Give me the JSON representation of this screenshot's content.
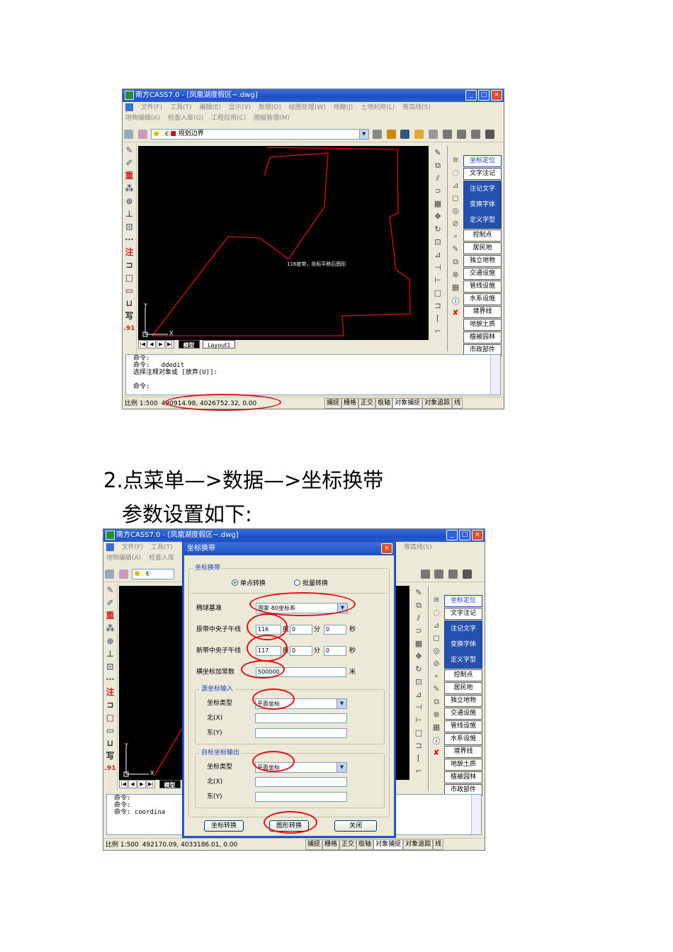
{
  "screenshot1": {
    "app_title": "南方CASS7.0 - [凤凰湖度假区~.dwg]",
    "menu_row1": [
      "文件(F)",
      "工具(T)",
      "编辑(E)",
      "显示(V)",
      "数据(D)",
      "绘图处理(W)",
      "地籍(J)",
      "土地利用(L)",
      "等高线(S)"
    ],
    "menu_row2": [
      "地物编辑(A)",
      "检查入库(G)",
      "工程应用(C)",
      "图幅管理(M)"
    ],
    "layer_name": "规划边界",
    "left_tool_labels": [
      "重",
      "注",
      ".91"
    ],
    "canvas_label": "116度带，坐标平移后图形",
    "axis_y": "Y",
    "axis_x": "X",
    "tab_model": "模型",
    "tab_layout": "Layout1",
    "side_items_top": [
      "坐标定位",
      "文字注记"
    ],
    "side_blue_items": [
      "注记文字",
      "变换字体",
      "定义字型"
    ],
    "side_items": [
      "控制点",
      "居民地",
      "独立地物",
      "交通设施",
      "管线设施",
      "水系设施",
      "境界线",
      "地貌土质",
      "植被园林",
      "市政部件"
    ],
    "command_lines": [
      "命令:",
      "命令:   ddedit",
      "选择注释对象或 [放弃(U)]:",
      "",
      "命令:"
    ],
    "status_scale": "比例  1:500",
    "status_coords": "490914.98, 4026752.32, 0.00",
    "status_buttons": [
      "捕捉",
      "栅格",
      "正交",
      "极轴",
      "对象捕捉",
      "对象追踪",
      "线"
    ]
  },
  "heading1": "2.点菜单—>数据—>坐标换带",
  "heading2": "参数设置如下:",
  "screenshot2": {
    "app_title": "南方CASS7.0 - [凤凰湖度假区~.dwg]",
    "menu_row1": [
      "文件(F)",
      "工具(T)"
    ],
    "menu_row1_right": "等高线(S)",
    "menu_row2": [
      "地物编辑(A)",
      "检查入库"
    ],
    "left_tool_labels": [
      "重",
      "注",
      ".91"
    ],
    "axis_y": "Y",
    "axis_x": "X",
    "tab_model": "模型",
    "side_items_top": [
      "坐标定位",
      "文字注记"
    ],
    "side_blue_items": [
      "注记文字",
      "变换字体",
      "定义字型"
    ],
    "side_items": [
      "控制点",
      "居民地",
      "独立地物",
      "交通设施",
      "管线设施",
      "水系设施",
      "境界线",
      "地貌土质",
      "植被园林",
      "市政部件"
    ],
    "command_lines": [
      "命令:",
      "命令:",
      "命令: coordina"
    ],
    "status_scale": "比例  1:500",
    "status_coords": "492170.09, 4033186.01, 0.00",
    "status_buttons": [
      "捕捉",
      "栅格",
      "正交",
      "极轴",
      "对象捕捉",
      "对象追踪",
      "线"
    ],
    "dialog": {
      "title": "坐标换带",
      "group_main": "坐标换带",
      "radio_single": "单点转换",
      "radio_batch": "批量转换",
      "ellipsoid_label": "椭球基准",
      "ellipsoid_value": "国家-80坐标系",
      "orig_meridian_label": "原带中央子午线",
      "orig_meridian_deg": "116",
      "new_meridian_label": "新带中央子午线",
      "new_meridian_deg": "117",
      "unit_deg": "度",
      "unit_min": "分",
      "unit_sec": "秒",
      "zero": "0",
      "false_easting_label": "横坐标加常数",
      "false_easting_value": "500000",
      "unit_meter": "米",
      "group_source": "源坐标输入",
      "coord_type_label": "坐标类型",
      "source_coord_type": "平面坐标",
      "north_label": "北(X)",
      "east_label": "东(Y)",
      "group_target": "目标坐标输出",
      "target_coord_type": "平面坐标",
      "btn_convert": "坐标转换",
      "btn_graphic": "图形转换",
      "btn_close": "关闭"
    }
  }
}
